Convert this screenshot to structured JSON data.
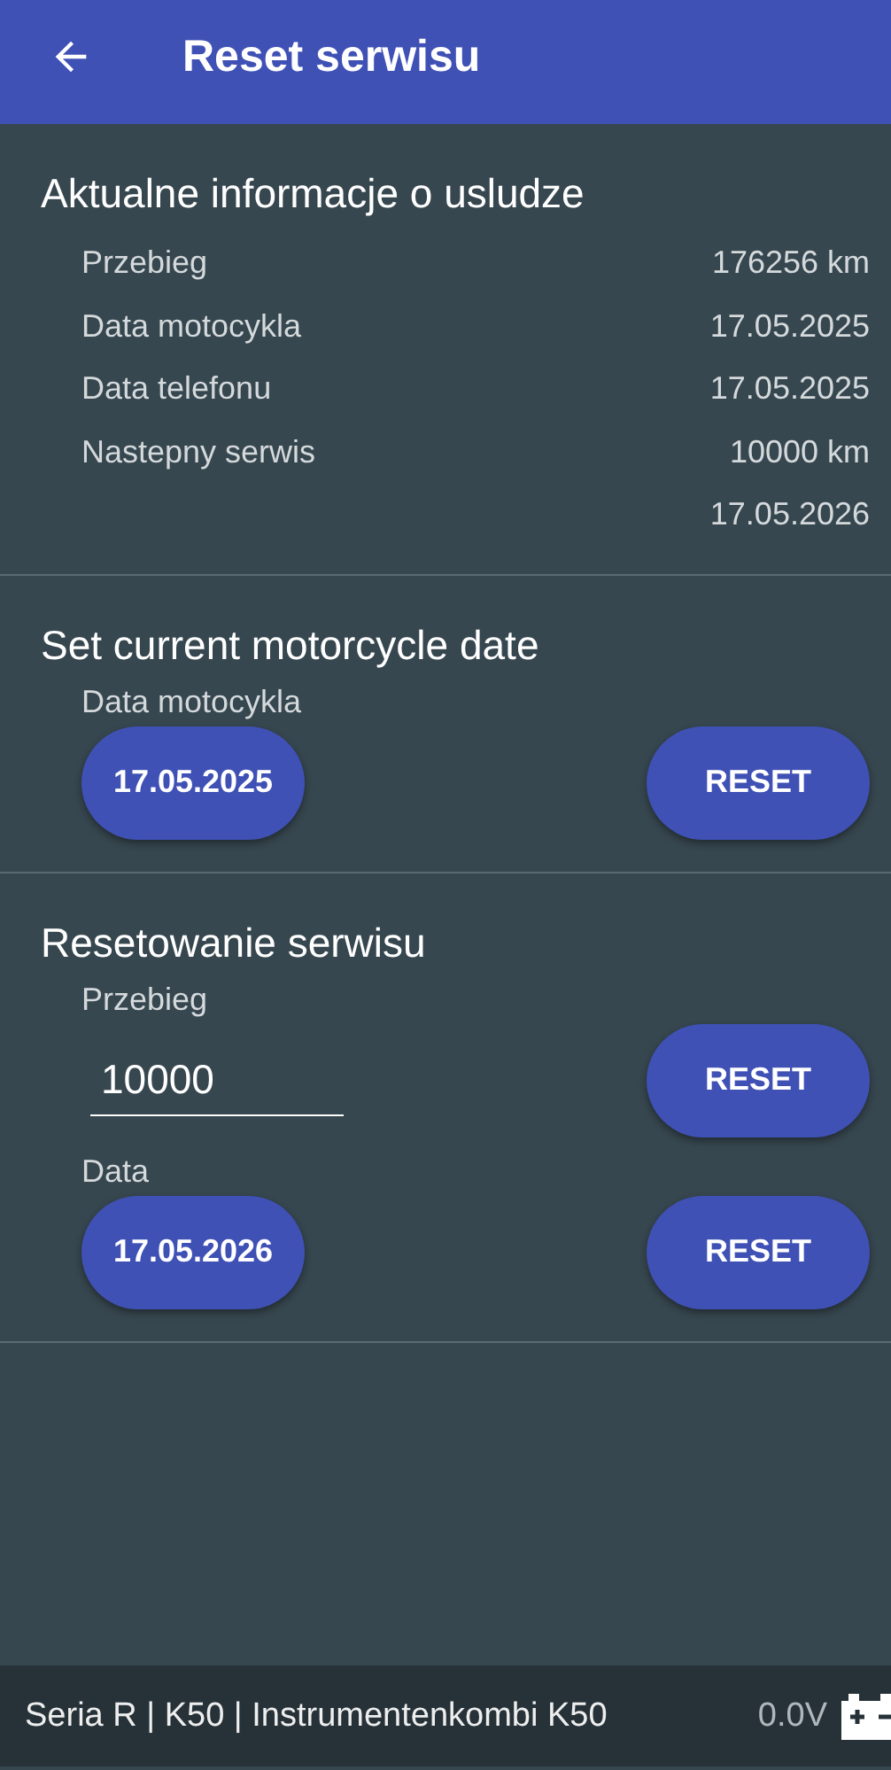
{
  "header": {
    "title": "Reset serwisu"
  },
  "info": {
    "title": "Aktualne informacje o usludze",
    "rows": [
      {
        "label": "Przebieg",
        "value": "176256 km"
      },
      {
        "label": "Data motocykla",
        "value": "17.05.2025"
      },
      {
        "label": "Data telefonu",
        "value": "17.05.2025"
      },
      {
        "label": "Nastepny serwis",
        "value": "10000 km"
      },
      {
        "value": "17.05.2026"
      }
    ]
  },
  "sections": [
    {
      "title": "Set current motorcycle date",
      "rows": [
        {
          "label": "Data motocykla",
          "kind": "date",
          "value": "17.05.2025",
          "button": "RESET"
        }
      ]
    },
    {
      "title": "Resetowanie serwisu",
      "rows": [
        {
          "label": "Przebieg",
          "kind": "input",
          "value": "10000",
          "button": "RESET"
        },
        {
          "label": "Data",
          "kind": "date",
          "value": "17.05.2026",
          "button": "RESET"
        }
      ]
    }
  ],
  "status_bar": {
    "text": "Seria R | K50 | Instrumentenkombi K50",
    "voltage": "0.0V"
  }
}
